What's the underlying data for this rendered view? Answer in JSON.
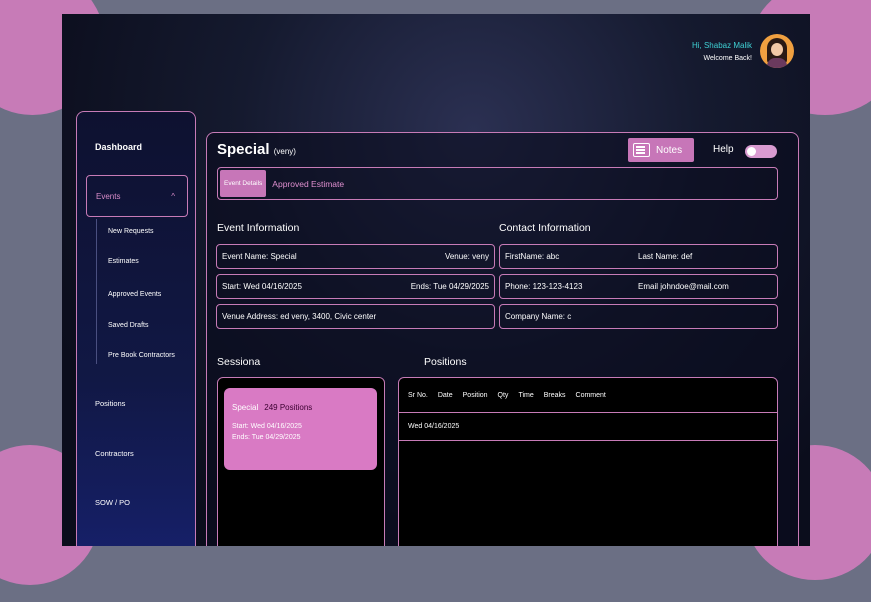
{
  "header": {
    "greeting": "Hi, Shabaz Malik",
    "welcome": "Welcome Back!",
    "avatar_icon": "user-avatar"
  },
  "sidebar": {
    "dashboard": "Dashboard",
    "events": "Events",
    "events_chevron": "^",
    "sub_items": [
      "New Requests",
      "Estimates",
      "Approved Events",
      "Saved Drafts",
      "Pre Book Contractors"
    ],
    "items": [
      "Positions",
      "Contractors",
      "SOW / PO"
    ]
  },
  "page": {
    "title": "Special",
    "subtitle": "(veny)",
    "notes_label": "Notes",
    "help_label": "Help"
  },
  "tabs": {
    "active": "Event Details",
    "other": "Approved Estimate"
  },
  "event_info": {
    "title": "Event Information",
    "event_name": "Event Name: Special",
    "venue": "Venue: veny",
    "start": "Start: Wed 04/16/2025",
    "ends": "Ends: Tue 04/29/2025",
    "address": "Venue Address: ed veny, 3400, Civic center"
  },
  "contact_info": {
    "title": "Contact Information",
    "first_name": "FirstName: abc",
    "last_name": "Last Name: def",
    "phone": "Phone: 123-123-4123",
    "email": "Email johndoe@mail.com",
    "company": "Company  Name: c"
  },
  "sessions": {
    "title": "Sessiona",
    "card": {
      "name": "Special",
      "count": "249 Positions",
      "start": "Start: Wed 04/16/2025",
      "ends": "Ends: Tue 04/29/2025"
    }
  },
  "positions": {
    "title": "Positions",
    "columns": [
      "Sr No.",
      "Date",
      "Position",
      "Qty",
      "Time",
      "Breaks",
      "Comment"
    ],
    "rows": [
      {
        "date": "Wed 04/16/2025"
      }
    ]
  },
  "colors": {
    "accent": "#c776b8",
    "teal": "#3fd0d4",
    "background": "#6b6f84"
  }
}
